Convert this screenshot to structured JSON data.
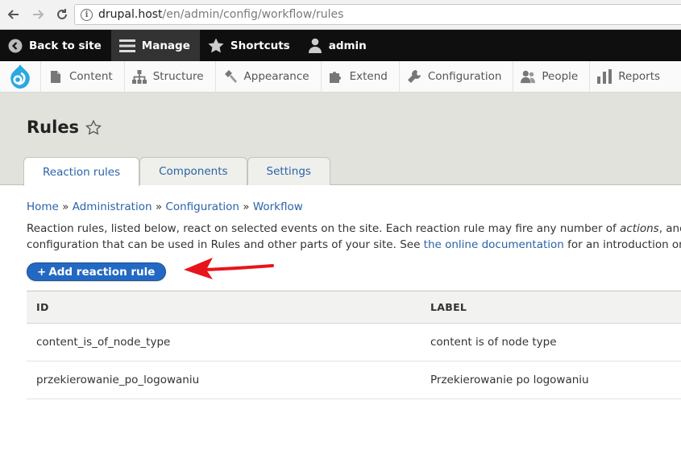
{
  "browser": {
    "url_host": "drupal.host",
    "url_path": "/en/admin/config/workflow/rules"
  },
  "toolbar": {
    "back_to_site": "Back to site",
    "manage": "Manage",
    "shortcuts": "Shortcuts",
    "user": "admin"
  },
  "tray": {
    "items": [
      "Content",
      "Structure",
      "Appearance",
      "Extend",
      "Configuration",
      "People",
      "Reports"
    ]
  },
  "page": {
    "title": "Rules"
  },
  "tabs": [
    "Reaction rules",
    "Components",
    "Settings"
  ],
  "breadcrumb": [
    "Home",
    "Administration",
    "Configuration",
    "Workflow"
  ],
  "breadcrumb_separator": "»",
  "description": {
    "line1_prefix": "Reaction rules, listed below, react on selected events on the site. Each reaction rule may fire any number of ",
    "line1_em": "actions",
    "line1_suffix": ", and ma",
    "line2_prefix": "configuration that can be used in Rules and other parts of your site. See ",
    "line2_link": "the online documentation",
    "line2_suffix": " for an introduction on how"
  },
  "add_button": {
    "plus": "+",
    "label": "Add reaction rule"
  },
  "table": {
    "headers": {
      "id": "ID",
      "label": "LABEL"
    },
    "rows": [
      {
        "id": "content_is_of_node_type",
        "label": "content is of node type"
      },
      {
        "id": "przekierowanie_po_logowaniu",
        "label": "Przekierowanie po logowaniu"
      }
    ]
  },
  "colors": {
    "accent": "#2369c4",
    "link": "#2b63a8",
    "toolbar": "#0f0f0f",
    "arrow": "#e8141c"
  }
}
